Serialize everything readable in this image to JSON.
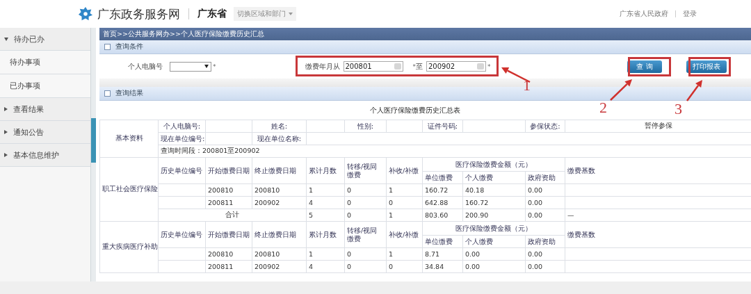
{
  "header": {
    "site_title": "广东政务服务网",
    "region": "广东省",
    "region_switch": "切换区域和部门",
    "links": [
      "广东省人民政府",
      "登录"
    ]
  },
  "sidebar": {
    "items": [
      {
        "label": "待办已办",
        "expanded": true,
        "children": [
          {
            "label": "待办事项"
          },
          {
            "label": "已办事项"
          }
        ]
      },
      {
        "label": "查看结果",
        "expanded": false
      },
      {
        "label": "通知公告",
        "expanded": false
      },
      {
        "label": "基本信息维护",
        "expanded": false
      }
    ]
  },
  "breadcrumb": "首页>>公共服务网办>>个人医疗保险缴费历史汇总",
  "query_panel": {
    "title": "查询条件",
    "expanded": false,
    "pc_number": {
      "label": "个人电脑号",
      "marker": "*"
    },
    "date_range": {
      "label": "缴费年月从",
      "from": "200801",
      "from_marker": "*",
      "separator": "至",
      "to": "200902",
      "to_marker": "*"
    },
    "buttons": [
      "查 询",
      "打印报表"
    ]
  },
  "results_panel": {
    "title": "查询结果",
    "expanded": false
  },
  "table": {
    "title": "个人医疗保险缴费历史汇总表",
    "basic_info": {
      "label": "基本资料",
      "rows": [
        [
          {
            "kind": "label",
            "text": "个人电脑号:"
          },
          {
            "kind": "value"
          },
          {
            "kind": "label",
            "text": "姓名:"
          },
          {
            "kind": "value"
          },
          {
            "kind": "label",
            "text": "性别:"
          },
          {
            "kind": "value"
          },
          {
            "kind": "label",
            "text": "证件号码:"
          },
          {
            "kind": "value"
          },
          {
            "kind": "label",
            "text": "参保状态:"
          },
          {
            "kind": "value",
            "text": "暂停参保"
          }
        ],
        [
          {
            "kind": "label",
            "text": "现在单位编号:"
          },
          {
            "kind": "value"
          },
          {
            "kind": "label",
            "text": "现在单位名称:"
          },
          {
            "kind": "value"
          }
        ]
      ],
      "query_period": "查询时间段：200801至200902"
    },
    "sections": [
      {
        "title": "职工社会医疗保险",
        "columns": [
          "历史单位编号",
          "开始缴费日期",
          "终止缴费日期",
          "累计月数",
          "转移/视同缴费",
          "补收/补缴"
        ],
        "amount_group": "医疗保险缴费金额（元）",
        "amount_columns": [
          "单位缴费",
          "个人缴费",
          "政府资助"
        ],
        "base_column": "缴费基数",
        "rows": [
          [
            null,
            "200810",
            "200810",
            "1",
            "0",
            "1",
            "160.72",
            "40.18",
            "0.00",
            null
          ],
          [
            null,
            "200811",
            "200902",
            "4",
            "0",
            "0",
            "642.88",
            "160.72",
            "0.00",
            null
          ]
        ],
        "total": {
          "label": "合计",
          "values": [
            "5",
            "0",
            "1",
            "803.60",
            "200.90",
            "0.00",
            "—"
          ]
        }
      },
      {
        "title": "重大疾病医疗补助",
        "columns": [
          "历史单位编号",
          "开始缴费日期",
          "终止缴费日期",
          "累计月数",
          "转移/视同缴费",
          "补收/补缴"
        ],
        "amount_group": "医疗保险缴费金额（元）",
        "amount_columns": [
          "单位缴费",
          "个人缴费",
          "政府资助"
        ],
        "base_column": "缴费基数",
        "rows": [
          [
            null,
            "200810",
            "200810",
            "1",
            "0",
            "1",
            "8.71",
            "0.00",
            "0.00",
            null
          ],
          [
            null,
            "200811",
            "200902",
            "4",
            "0",
            "0",
            "34.84",
            "0.00",
            "0.00",
            null
          ]
        ]
      }
    ]
  },
  "annotations": [
    {
      "label": "1"
    },
    {
      "label": "2"
    },
    {
      "label": "3"
    }
  ]
}
